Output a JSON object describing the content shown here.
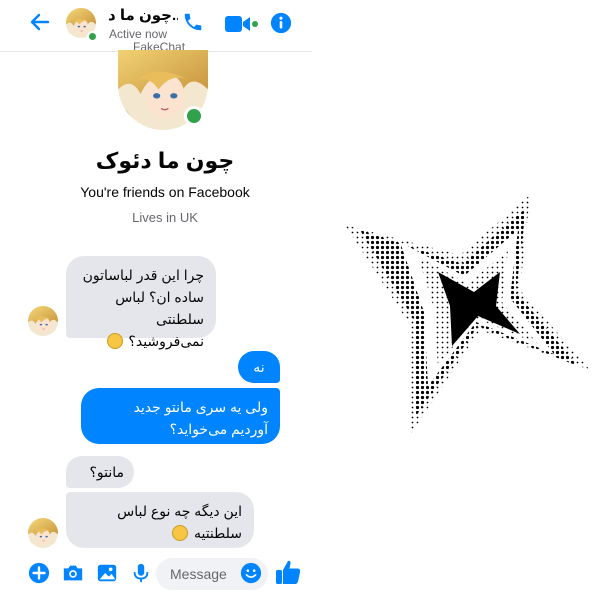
{
  "header": {
    "contact_name": "چون ما د...",
    "status": "Active now",
    "watermark": "FakeChat",
    "icons": [
      "back-arrow-icon",
      "phone-icon",
      "video-icon",
      "info-icon"
    ]
  },
  "profile": {
    "name": "چون ما دئوک",
    "friends_text": "You're friends on Facebook",
    "location_text": "Lives in UK"
  },
  "messages": [
    {
      "direction": "incoming",
      "text": "چرا این قدر لباساتون ساده ان؟  لباس سلطنتی نمی‌فروشید؟",
      "emoji": "slightly-frowning-face"
    },
    {
      "direction": "outgoing",
      "text": "نه"
    },
    {
      "direction": "outgoing",
      "text": "ولی یه سری مانتو جدید آوردیم می‌خواید؟"
    },
    {
      "direction": "incoming",
      "text": "مانتو؟"
    },
    {
      "direction": "incoming",
      "text": "این دیگه چه نوع لباس سلطنتیه",
      "emoji": "face-with-hand-over-mouth"
    }
  ],
  "composer": {
    "placeholder": "Message",
    "icons": [
      "add-circle-icon",
      "camera-icon",
      "image-icon",
      "microphone-icon",
      "emoji-icon",
      "like-thumb-icon"
    ]
  },
  "colors": {
    "accent": "#0084ff",
    "incoming_bubble": "#e4e6eb",
    "online": "#31a24c"
  }
}
